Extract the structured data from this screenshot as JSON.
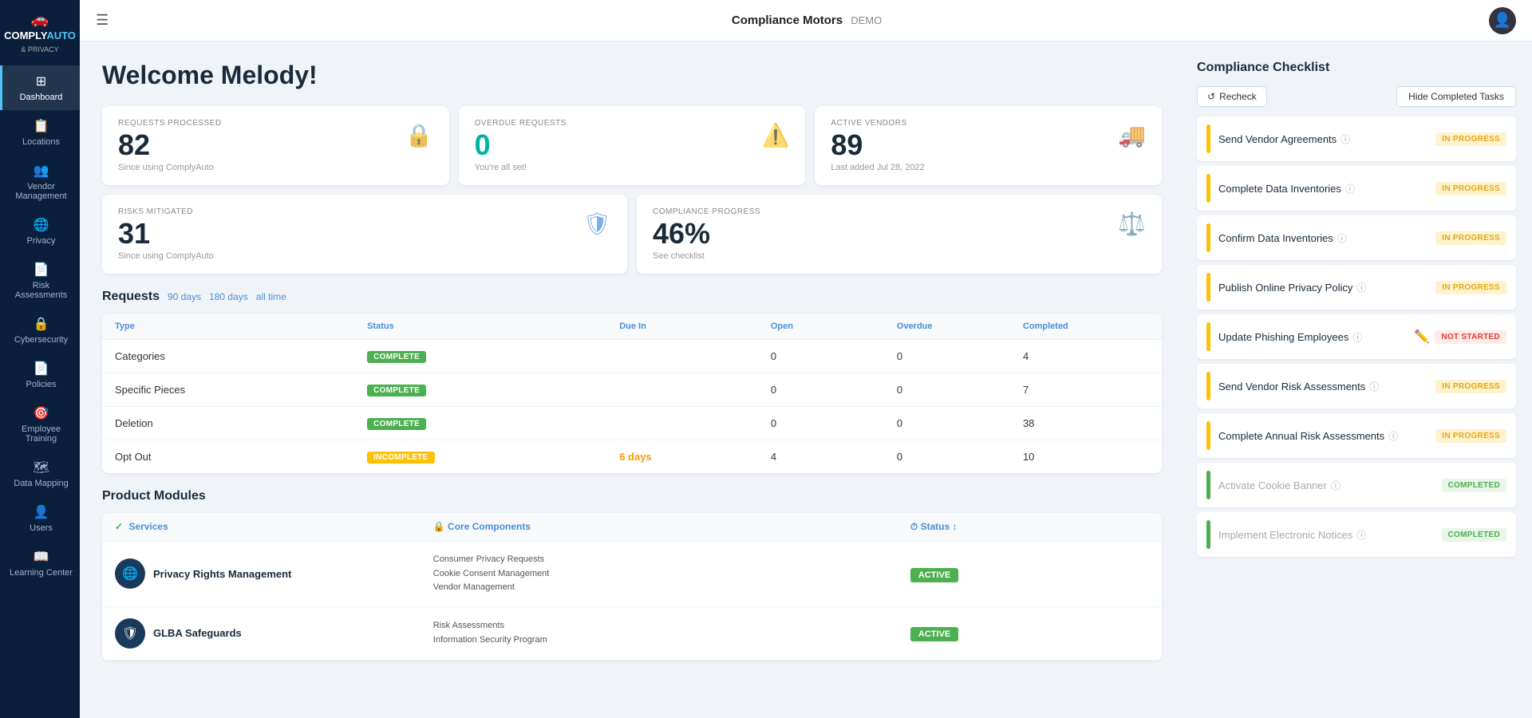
{
  "sidebar": {
    "logo": "COMPLYAUTO & PRIVACY",
    "items": [
      {
        "id": "dashboard",
        "label": "Dashboard",
        "icon": "⊞",
        "active": true
      },
      {
        "id": "locations",
        "label": "Locations",
        "icon": "📋"
      },
      {
        "id": "vendor",
        "label": "Vendor Management",
        "icon": "👥",
        "hasArrow": true
      },
      {
        "id": "privacy",
        "label": "Privacy",
        "icon": "🌐",
        "hasArrow": true
      },
      {
        "id": "risk",
        "label": "Risk Assessments",
        "icon": "📄"
      },
      {
        "id": "cybersecurity",
        "label": "Cybersecurity",
        "icon": "🔒",
        "hasArrow": true
      },
      {
        "id": "policies",
        "label": "Policies",
        "icon": "📄",
        "hasArrow": true
      },
      {
        "id": "training",
        "label": "Employee Training",
        "icon": "🎯"
      },
      {
        "id": "data-mapping",
        "label": "Data Mapping",
        "icon": "🗺",
        "hasArrow": true
      },
      {
        "id": "users",
        "label": "Users",
        "icon": "👤"
      },
      {
        "id": "learning",
        "label": "Learning Center",
        "icon": "📖"
      }
    ]
  },
  "topbar": {
    "company": "Compliance Motors",
    "demo": "DEMO",
    "toggle_icon": "☰"
  },
  "welcome": {
    "title": "Welcome Melody!"
  },
  "stats": {
    "requests_processed": {
      "label": "REQUESTS PROCESSED",
      "value": "82",
      "sub": "Since using ComplyAuto"
    },
    "overdue_requests": {
      "label": "OVERDUE REQUESTS",
      "value": "0",
      "sub": "You're all set!"
    },
    "active_vendors": {
      "label": "ACTIVE VENDORS",
      "value": "89",
      "sub": "Last added Jul 28, 2022"
    },
    "risks_mitigated": {
      "label": "RISKS MITIGATED",
      "value": "31",
      "sub": "Since using ComplyAuto"
    },
    "compliance_progress": {
      "label": "COMPLIANCE PROGRESS",
      "value": "46%",
      "sub": "See checklist"
    }
  },
  "requests": {
    "title": "Requests",
    "filters": [
      "90 days",
      "180 days",
      "all time"
    ],
    "columns": [
      "Type",
      "Status",
      "Due In",
      "Open",
      "Overdue",
      "Completed"
    ],
    "rows": [
      {
        "type": "Categories",
        "status": "COMPLETE",
        "status_type": "complete",
        "due_in": "",
        "open": "0",
        "overdue": "0",
        "completed": "4"
      },
      {
        "type": "Specific Pieces",
        "status": "COMPLETE",
        "status_type": "complete",
        "due_in": "",
        "open": "0",
        "overdue": "0",
        "completed": "7"
      },
      {
        "type": "Deletion",
        "status": "COMPLETE",
        "status_type": "complete",
        "due_in": "",
        "open": "0",
        "overdue": "0",
        "completed": "38"
      },
      {
        "type": "Opt Out",
        "status": "INCOMPLETE",
        "status_type": "incomplete",
        "due_in": "6 days",
        "due_overdue": true,
        "open": "4",
        "overdue": "0",
        "completed": "10"
      }
    ]
  },
  "product_modules": {
    "title": "Product Modules",
    "columns": {
      "services": "Services",
      "core": "Core Components",
      "status": "Status"
    },
    "rows": [
      {
        "name": "Privacy Rights Management",
        "icon": "🌐",
        "cores": [
          "Consumer Privacy Requests",
          "Cookie Consent Management",
          "Vendor Management"
        ],
        "status": "ACTIVE"
      },
      {
        "name": "GLBA Safeguards",
        "icon": "🛡",
        "cores": [
          "Risk Assessments",
          "Information Security Program"
        ],
        "status": "ACTIVE"
      }
    ]
  },
  "checklist": {
    "title": "Compliance Checklist",
    "recheck_label": "Recheck",
    "hide_completed_label": "Hide Completed Tasks",
    "items": [
      {
        "name": "Send Vendor Agreements",
        "status": "IN PROGRESS",
        "status_type": "in-progress",
        "dot": "yellow"
      },
      {
        "name": "Complete Data Inventories",
        "status": "IN PROGRESS",
        "status_type": "in-progress",
        "dot": "yellow"
      },
      {
        "name": "Confirm Data Inventories",
        "status": "IN PROGRESS",
        "status_type": "in-progress",
        "dot": "yellow"
      },
      {
        "name": "Publish Online Privacy Policy",
        "status": "IN PROGRESS",
        "status_type": "in-progress",
        "dot": "yellow"
      },
      {
        "name": "Update Phishing Employees",
        "status": "NOT STARTED",
        "status_type": "not-started",
        "dot": "yellow"
      },
      {
        "name": "Send Vendor Risk Assessments",
        "status": "IN PROGRESS",
        "status_type": "in-progress",
        "dot": "yellow"
      },
      {
        "name": "Complete Annual Risk Assessments",
        "status": "IN PROGRESS",
        "status_type": "in-progress",
        "dot": "yellow"
      },
      {
        "name": "Activate Cookie Banner",
        "status": "COMPLETED",
        "status_type": "completed",
        "dot": "green",
        "muted": true
      },
      {
        "name": "Implement Electronic Notices",
        "status": "COMPLETED",
        "status_type": "completed",
        "dot": "green",
        "muted": true
      }
    ]
  }
}
